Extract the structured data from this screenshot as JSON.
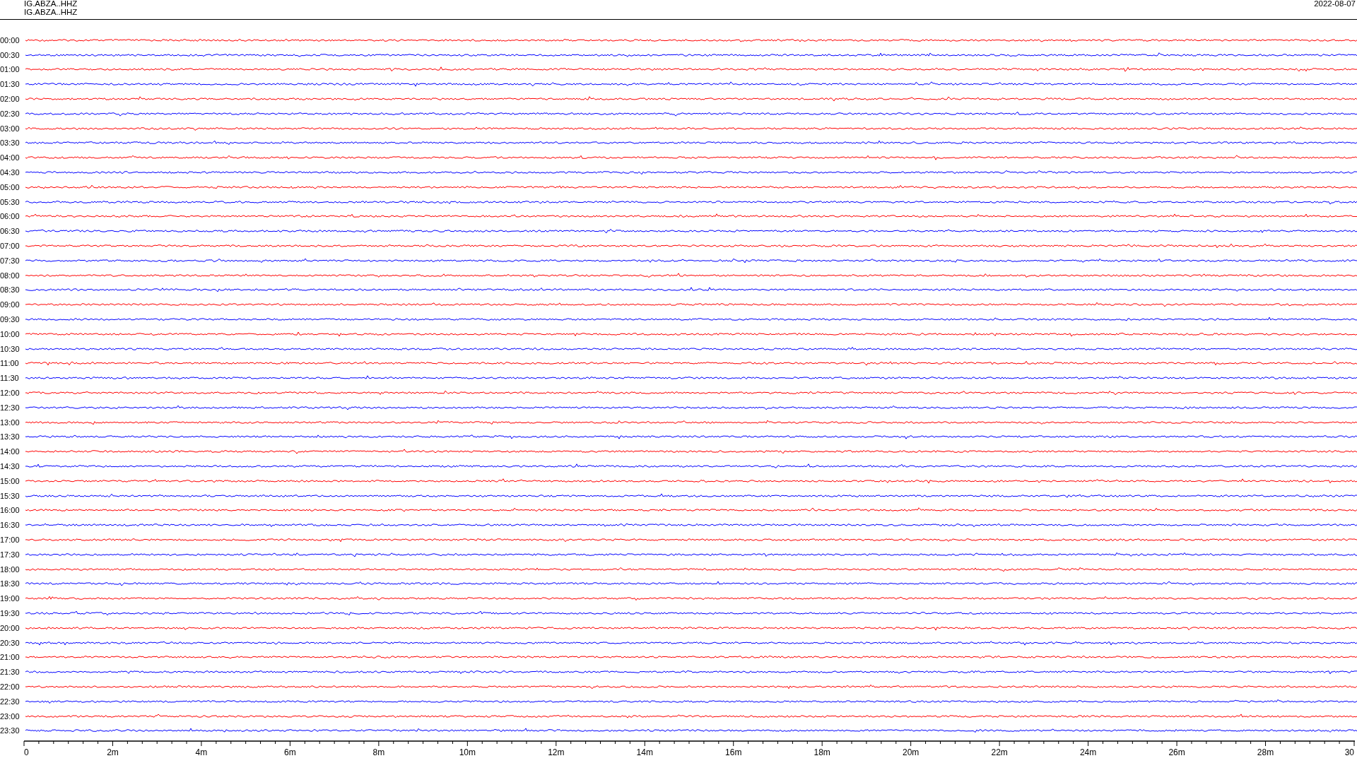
{
  "header": {
    "station_lines": [
      "IG.ABZA..HHZ",
      "IG.ABZA..HHZ"
    ],
    "date": "2022-08-07"
  },
  "traces": [
    {
      "time": "00:00",
      "color": "#ff0000"
    },
    {
      "time": "00:30",
      "color": "#0000ff"
    },
    {
      "time": "01:00",
      "color": "#ff0000"
    },
    {
      "time": "01:30",
      "color": "#0000ff"
    },
    {
      "time": "02:00",
      "color": "#ff0000"
    },
    {
      "time": "02:30",
      "color": "#0000ff"
    },
    {
      "time": "03:00",
      "color": "#ff0000"
    },
    {
      "time": "03:30",
      "color": "#0000ff"
    },
    {
      "time": "04:00",
      "color": "#ff0000"
    },
    {
      "time": "04:30",
      "color": "#0000ff"
    },
    {
      "time": "05:00",
      "color": "#ff0000"
    },
    {
      "time": "05:30",
      "color": "#0000ff"
    },
    {
      "time": "06:00",
      "color": "#ff0000"
    },
    {
      "time": "06:30",
      "color": "#0000ff"
    },
    {
      "time": "07:00",
      "color": "#ff0000"
    },
    {
      "time": "07:30",
      "color": "#0000ff"
    },
    {
      "time": "08:00",
      "color": "#ff0000"
    },
    {
      "time": "08:30",
      "color": "#0000ff"
    },
    {
      "time": "09:00",
      "color": "#ff0000"
    },
    {
      "time": "09:30",
      "color": "#0000ff"
    },
    {
      "time": "10:00",
      "color": "#ff0000"
    },
    {
      "time": "10:30",
      "color": "#0000ff"
    },
    {
      "time": "11:00",
      "color": "#ff0000"
    },
    {
      "time": "11:30",
      "color": "#0000ff"
    },
    {
      "time": "12:00",
      "color": "#ff0000"
    },
    {
      "time": "12:30",
      "color": "#0000ff"
    },
    {
      "time": "13:00",
      "color": "#ff0000"
    },
    {
      "time": "13:30",
      "color": "#0000ff"
    },
    {
      "time": "14:00",
      "color": "#ff0000"
    },
    {
      "time": "14:30",
      "color": "#0000ff"
    },
    {
      "time": "15:00",
      "color": "#ff0000"
    },
    {
      "time": "15:30",
      "color": "#0000ff"
    },
    {
      "time": "16:00",
      "color": "#ff0000"
    },
    {
      "time": "16:30",
      "color": "#0000ff"
    },
    {
      "time": "17:00",
      "color": "#ff0000"
    },
    {
      "time": "17:30",
      "color": "#0000ff"
    },
    {
      "time": "18:00",
      "color": "#ff0000"
    },
    {
      "time": "18:30",
      "color": "#0000ff"
    },
    {
      "time": "19:00",
      "color": "#ff0000"
    },
    {
      "time": "19:30",
      "color": "#0000ff"
    },
    {
      "time": "20:00",
      "color": "#ff0000"
    },
    {
      "time": "20:30",
      "color": "#0000ff"
    },
    {
      "time": "21:00",
      "color": "#ff0000"
    },
    {
      "time": "21:30",
      "color": "#0000ff"
    },
    {
      "time": "22:00",
      "color": "#ff0000"
    },
    {
      "time": "22:30",
      "color": "#0000ff"
    },
    {
      "time": "23:00",
      "color": "#ff0000"
    },
    {
      "time": "23:30",
      "color": "#0000ff"
    }
  ],
  "x_axis": {
    "ticks": [
      "0",
      "2m",
      "4m",
      "6m",
      "8m",
      "10m",
      "12m",
      "14m",
      "16m",
      "18m",
      "20m",
      "22m",
      "24m",
      "26m",
      "28m",
      "30"
    ]
  }
}
